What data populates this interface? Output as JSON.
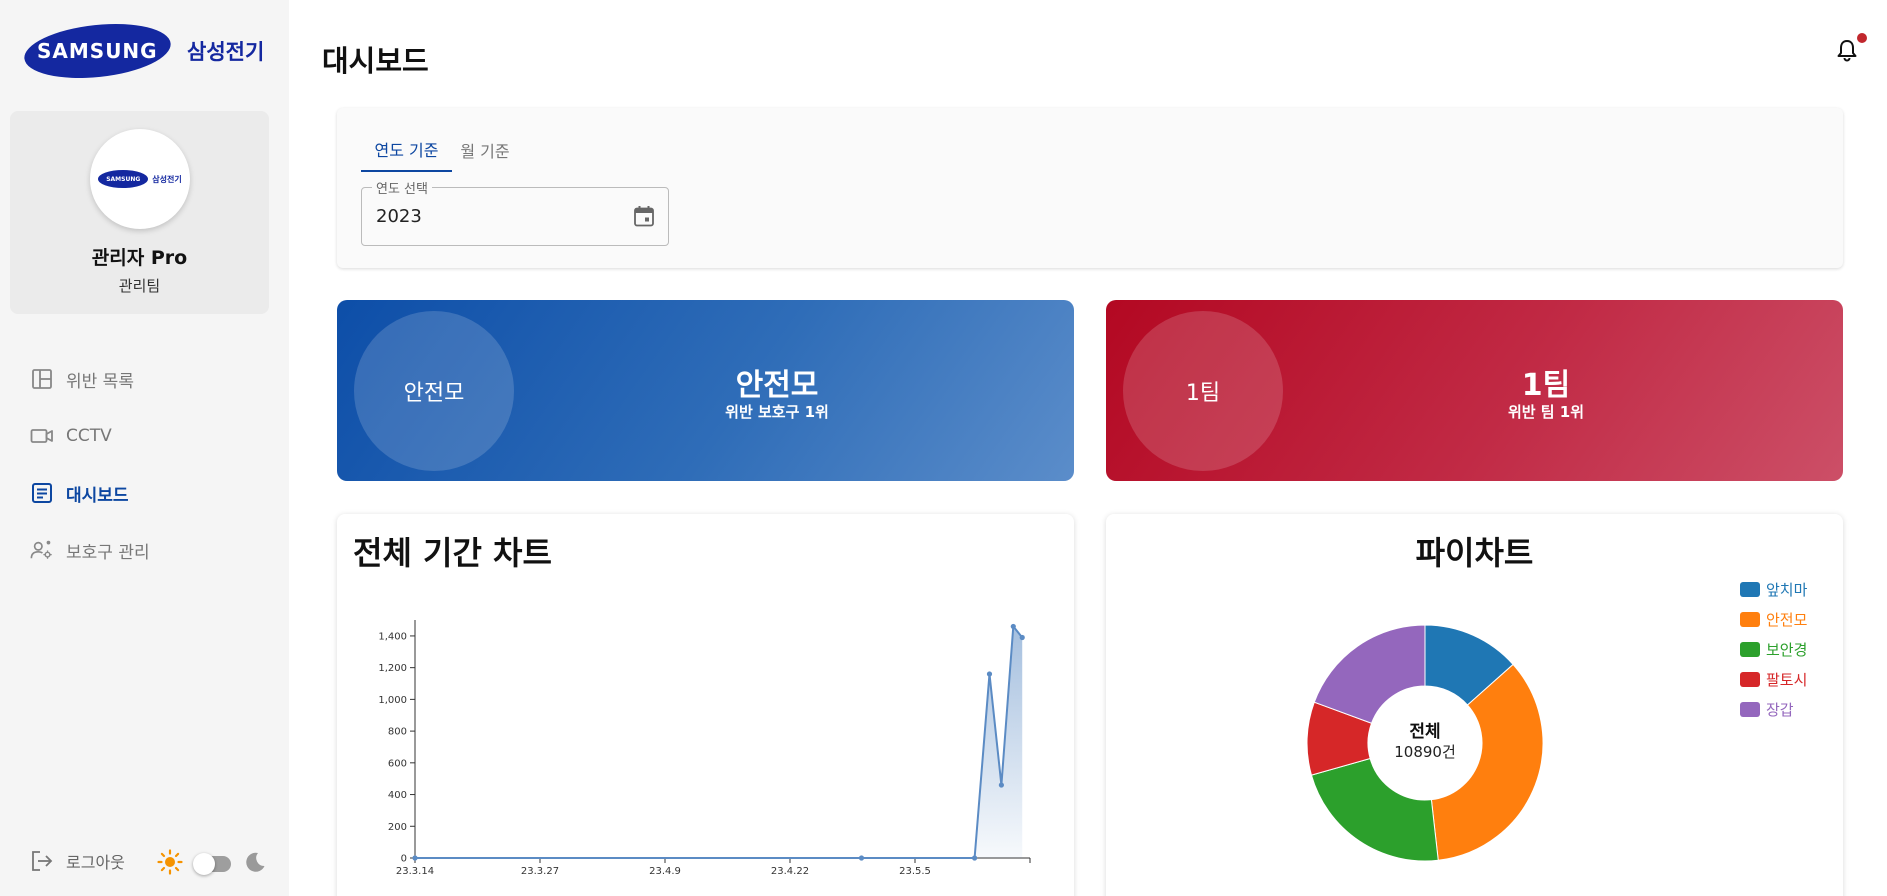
{
  "sidebar": {
    "logo_wordmark": "SAMSUNG",
    "logo_text": "삼성전기",
    "profile": {
      "name": "관리자 Pro",
      "team": "관리팀"
    },
    "nav": [
      {
        "label": "위반 목록",
        "icon": "dashboard-layout-icon",
        "active": false
      },
      {
        "label": "CCTV",
        "icon": "video-camera-icon",
        "active": false
      },
      {
        "label": "대시보드",
        "icon": "article-icon",
        "active": true
      },
      {
        "label": "보호구 관리",
        "icon": "manage-accounts-icon",
        "active": false
      }
    ],
    "logout_label": "로그아웃",
    "theme": {
      "mode": "light",
      "light_icon": "sun-icon",
      "dark_icon": "moon-icon"
    }
  },
  "header": {
    "title": "대시보드",
    "notification_icon": "bell-icon",
    "has_notification": true
  },
  "filter": {
    "tabs": [
      {
        "label": "연도 기준",
        "selected": true
      },
      {
        "label": "월 기준",
        "selected": false
      }
    ],
    "year_field": {
      "label": "연도 선택",
      "value": "2023",
      "icon": "calendar-icon"
    }
  },
  "stats": {
    "top_gear": {
      "circle_label": "안전모",
      "title": "안전모",
      "subtitle": "위반 보호구 1위",
      "color": "#1f5fb0"
    },
    "top_team": {
      "circle_label": "1팀",
      "title": "1팀",
      "subtitle": "위반 팀 1위",
      "color": "#be1e3a"
    }
  },
  "line_chart_card": {
    "title": "전체 기간 차트"
  },
  "pie_chart_card": {
    "title": "파이차트",
    "center_title": "전체",
    "center_value": "10890건"
  },
  "chart_data": [
    {
      "type": "line",
      "title": "전체 기간 차트",
      "x_tick_labels": [
        "23.3.14",
        "23.3.27",
        "23.4.9",
        "23.4.22",
        "23.5.5"
      ],
      "y_tick_labels": [
        "0",
        "200",
        "400",
        "600",
        "800",
        "1,000",
        "1,200",
        "1,400"
      ],
      "ylim": [
        0,
        1450
      ],
      "x_range_days": [
        0,
        100
      ],
      "series": [
        {
          "color": "#5b8bc4",
          "x": [
            0,
            75,
            94,
            96.5,
            98.5,
            100.5,
            102
          ],
          "y": [
            0,
            0,
            0,
            1160,
            460,
            1460,
            1390
          ]
        }
      ]
    },
    {
      "type": "pie",
      "donut": true,
      "total": 10890,
      "slices": [
        {
          "label": "앞치마",
          "value": 1460,
          "color": "#1f77b4"
        },
        {
          "label": "안전모",
          "value": 3790,
          "color": "#ff7f0e"
        },
        {
          "label": "보안경",
          "value": 2440,
          "color": "#2ca02c"
        },
        {
          "label": "팔토시",
          "value": 1090,
          "color": "#d62728"
        },
        {
          "label": "장갑",
          "value": 2110,
          "color": "#9467bd"
        }
      ]
    }
  ]
}
